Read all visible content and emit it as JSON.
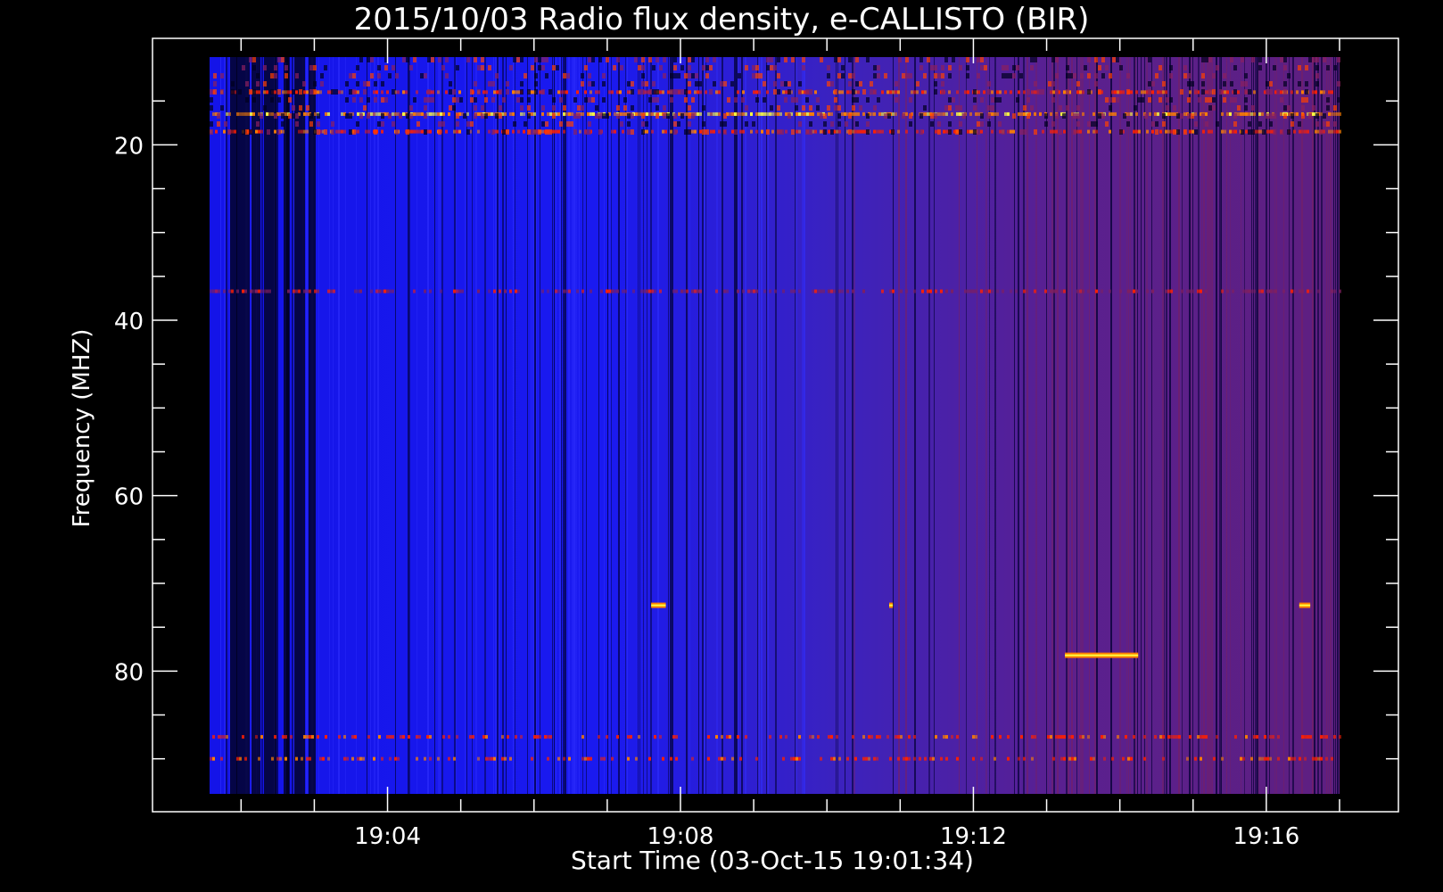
{
  "chart_data": {
    "type": "heatmap",
    "title": "2015/10/03  Radio flux density, e-CALLISTO (BIR)",
    "xlabel": "Start Time (03-Oct-15 19:01:34)",
    "ylabel": "Frequency (MHZ)",
    "x_ticks": [
      "19:04",
      "19:08",
      "19:12",
      "19:16"
    ],
    "y_ticks": [
      "20",
      "40",
      "60",
      "80"
    ],
    "y_tick_values": [
      20,
      40,
      60,
      80
    ],
    "x_tick_minutes": [
      4,
      8,
      12,
      16
    ],
    "xlim_minutes": [
      1.57,
      17.0
    ],
    "ylim": [
      10,
      94
    ],
    "y_inverted": true,
    "colormap": [
      "#000000",
      "#0000ff",
      "#7f1f5f",
      "#ff2000",
      "#ff8000",
      "#ffff40"
    ],
    "bursts": [
      {
        "t_start_min": 7.6,
        "t_end_min": 7.8,
        "freq_mhz": 72.5
      },
      {
        "t_start_min": 10.85,
        "t_end_min": 10.9,
        "freq_mhz": 72.5
      },
      {
        "t_start_min": 13.25,
        "t_end_min": 14.25,
        "freq_mhz": 78.2
      },
      {
        "t_start_min": 16.45,
        "t_end_min": 16.6,
        "freq_mhz": 72.5
      }
    ]
  }
}
